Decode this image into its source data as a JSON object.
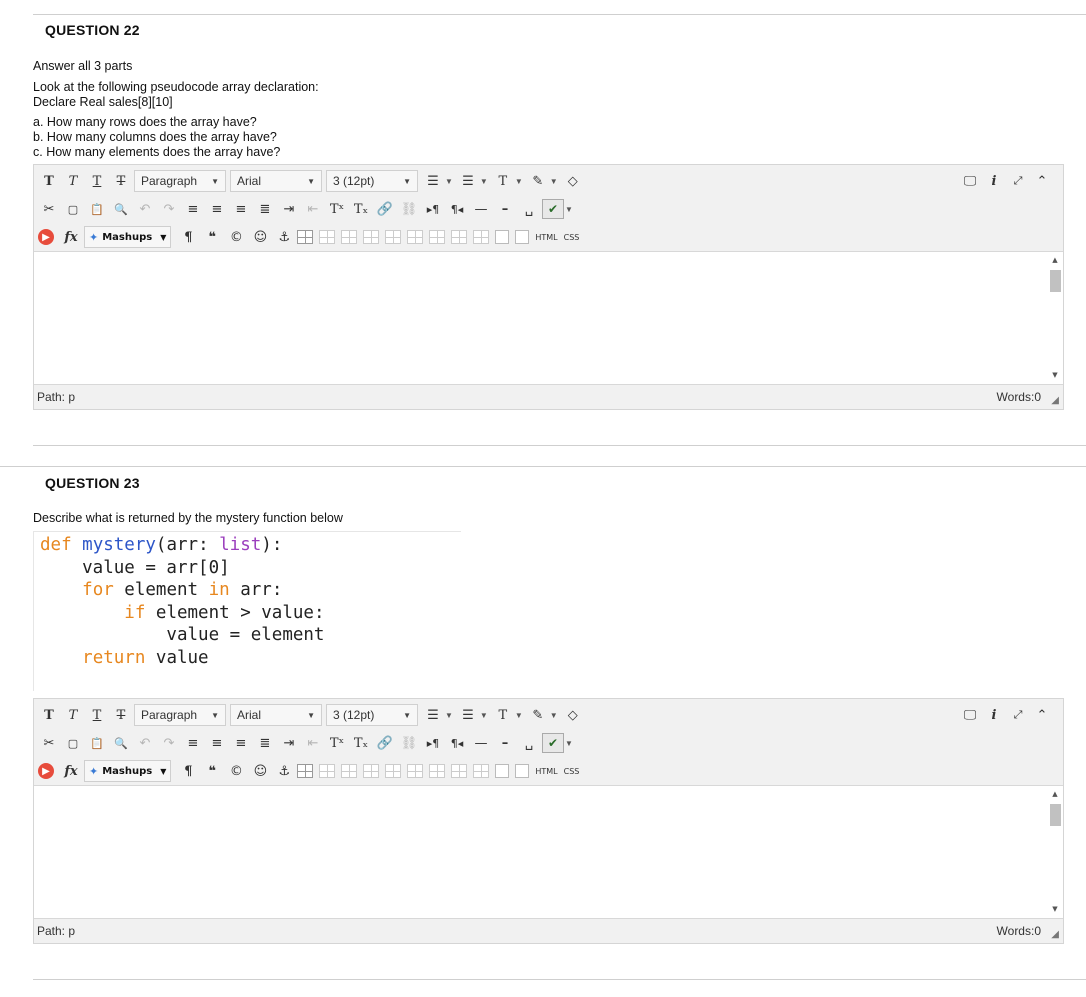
{
  "editor_common": {
    "format_dropdown": "Paragraph",
    "font_dropdown": "Arial",
    "size_dropdown": "3 (12pt)",
    "mashups_label": "Mashups",
    "html_label": "HTML",
    "css_label": "CSS",
    "path_label": "Path: p",
    "words_label": "Words:0"
  },
  "question22": {
    "title": "QUESTION 22",
    "lines": [
      "Answer all 3 parts",
      "Look at the following pseudocode array declaration:",
      "Declare Real sales[8][10]",
      "a. How many rows does the array have?",
      "b. How many columns does the array have?",
      "c. How many elements does the array have?"
    ]
  },
  "question23": {
    "title": "QUESTION 23",
    "prompt": "Describe what is returned by the mystery function below",
    "code": {
      "l1_def": "def",
      "l1_name": "mystery",
      "l1_open": "(arr: ",
      "l1_type": "list",
      "l1_close": "):",
      "l2": "    value = arr[0]",
      "l3_indent": "    ",
      "l3_for": "for",
      "l3_mid": " element ",
      "l3_in": "in",
      "l3_end": " arr:",
      "l4_indent": "        ",
      "l4_if": "if",
      "l4_end": " element > value:",
      "l5": "            value = element",
      "l6_indent": "    ",
      "l6_return": "return",
      "l6_end": " value"
    }
  },
  "colors": {
    "keyword": "#e7871f",
    "function": "#2d56c8",
    "type": "#9b3fbd"
  }
}
